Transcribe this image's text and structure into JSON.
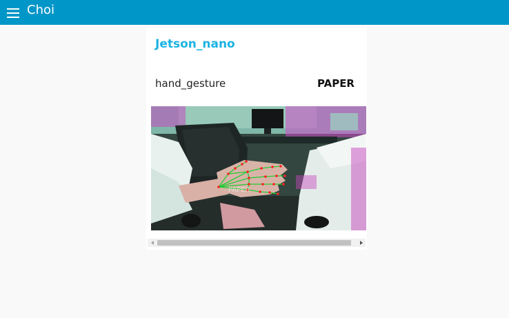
{
  "app": {
    "title": "Choi"
  },
  "group": {
    "title": "Jetson_nano"
  },
  "widget": {
    "label": "hand_gesture",
    "value": "PAPER"
  },
  "video": {
    "overlay_text": "PAPER"
  },
  "colors": {
    "header_bg": "#0196c8",
    "group_title": "#1ab3e2",
    "page_bg": "#f9f9f9",
    "landmark_lines": "#22cc33",
    "landmark_points": "#ff2020"
  },
  "icons": {
    "menu": "hamburger-menu-icon"
  }
}
